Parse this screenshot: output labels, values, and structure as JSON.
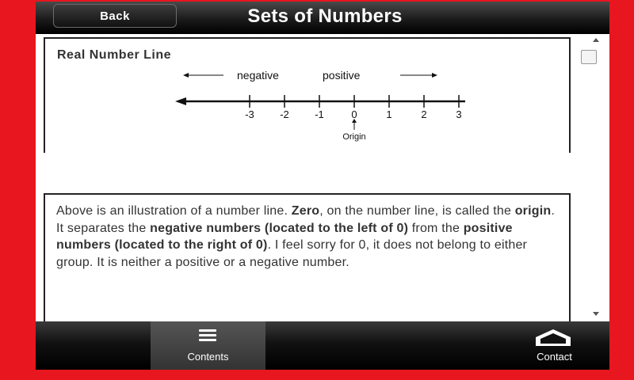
{
  "header": {
    "back_label": "Back",
    "title": "Sets of Numbers"
  },
  "figure": {
    "title": "Real Number Line",
    "negative_label": "negative",
    "positive_label": "positive",
    "ticks": [
      "-3",
      "-2",
      "-1",
      "0",
      "1",
      "2",
      "3"
    ],
    "origin_label": "Origin"
  },
  "paragraph": {
    "t1": "Above is an illustration of a number line. ",
    "b1": "Zero",
    "t2": ", on the number line, is called the ",
    "b2": "origin",
    "t3": ".  It separates the ",
    "b3": "negative numbers (located to the left of 0)",
    "t4": " from the ",
    "b4": "positive numbers (located to the right of 0)",
    "t5": ".  I feel sorry for 0, it does not belong to either group.  It is neither a positive or a negative number."
  },
  "footer": {
    "contents_label": "Contents",
    "contact_label": "Contact"
  },
  "icons": {
    "contents": "menu-icon",
    "contact": "home-icon"
  },
  "colors": {
    "frame": "#e8161e",
    "bar": "#1c1c1c",
    "active_tab": "#444444"
  }
}
